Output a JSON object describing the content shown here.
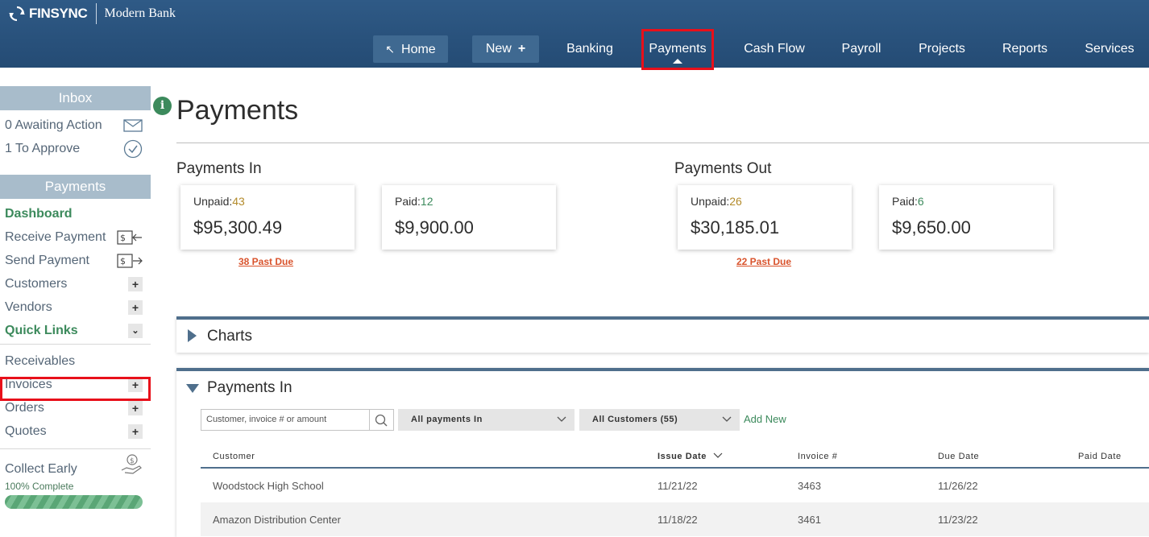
{
  "brand": {
    "logo_text": "FINSYNC",
    "bank_name": "Modern Bank"
  },
  "nav": {
    "home": "Home",
    "new": "New",
    "banking": "Banking",
    "payments": "Payments",
    "cash_flow": "Cash Flow",
    "payroll": "Payroll",
    "projects": "Projects",
    "reports": "Reports",
    "services": "Services",
    "active": "Payments"
  },
  "sidebar": {
    "inbox_header": "Inbox",
    "awaiting": "0 Awaiting Action",
    "to_approve": "1 To Approve",
    "payments_header": "Payments",
    "dashboard": "Dashboard",
    "receive_payment": "Receive Payment",
    "send_payment": "Send Payment",
    "customers": "Customers",
    "vendors": "Vendors",
    "quick_links": "Quick Links",
    "receivables": "Receivables",
    "invoices": "Invoices",
    "orders": "Orders",
    "quotes": "Quotes",
    "collect_early": "Collect Early",
    "progress_label": "100% Complete",
    "progress_value": 1.0
  },
  "main": {
    "title": "Payments",
    "info_icon": "i",
    "payments_in": {
      "label": "Payments In",
      "unpaid_label": "Unpaid:",
      "unpaid_count": "43",
      "unpaid_amount": "$95,300.49",
      "paid_label": "Paid:",
      "paid_count": "12",
      "paid_amount": "$9,900.00",
      "past_due": "38 Past Due"
    },
    "payments_out": {
      "label": "Payments Out",
      "unpaid_label": "Unpaid:",
      "unpaid_count": "26",
      "unpaid_amount": "$30,185.01",
      "paid_label": "Paid:",
      "paid_count": "6",
      "paid_amount": "$9,650.00",
      "past_due": "22 Past Due"
    },
    "charts_panel": "Charts",
    "payments_in_panel": "Payments In",
    "search_placeholder": "Customer, invoice # or amount",
    "filter_type": "All payments In",
    "filter_customer": "All Customers (55)",
    "add_new": "Add New",
    "columns": [
      "Customer",
      "Issue Date",
      "Invoice #",
      "Due Date",
      "Paid Date"
    ],
    "rows": [
      {
        "customer": "Woodstock High School",
        "issue_date": "11/21/22",
        "invoice": "3463",
        "due_date": "11/26/22",
        "paid_date": ""
      },
      {
        "customer": "Amazon Distribution Center",
        "issue_date": "11/18/22",
        "invoice": "3461",
        "due_date": "11/23/22",
        "paid_date": ""
      }
    ]
  },
  "colors": {
    "topbar": "#2f5a86",
    "accent_green": "#3c8a5c",
    "highlight_red": "#e8101a",
    "past_due": "#d9532c"
  }
}
